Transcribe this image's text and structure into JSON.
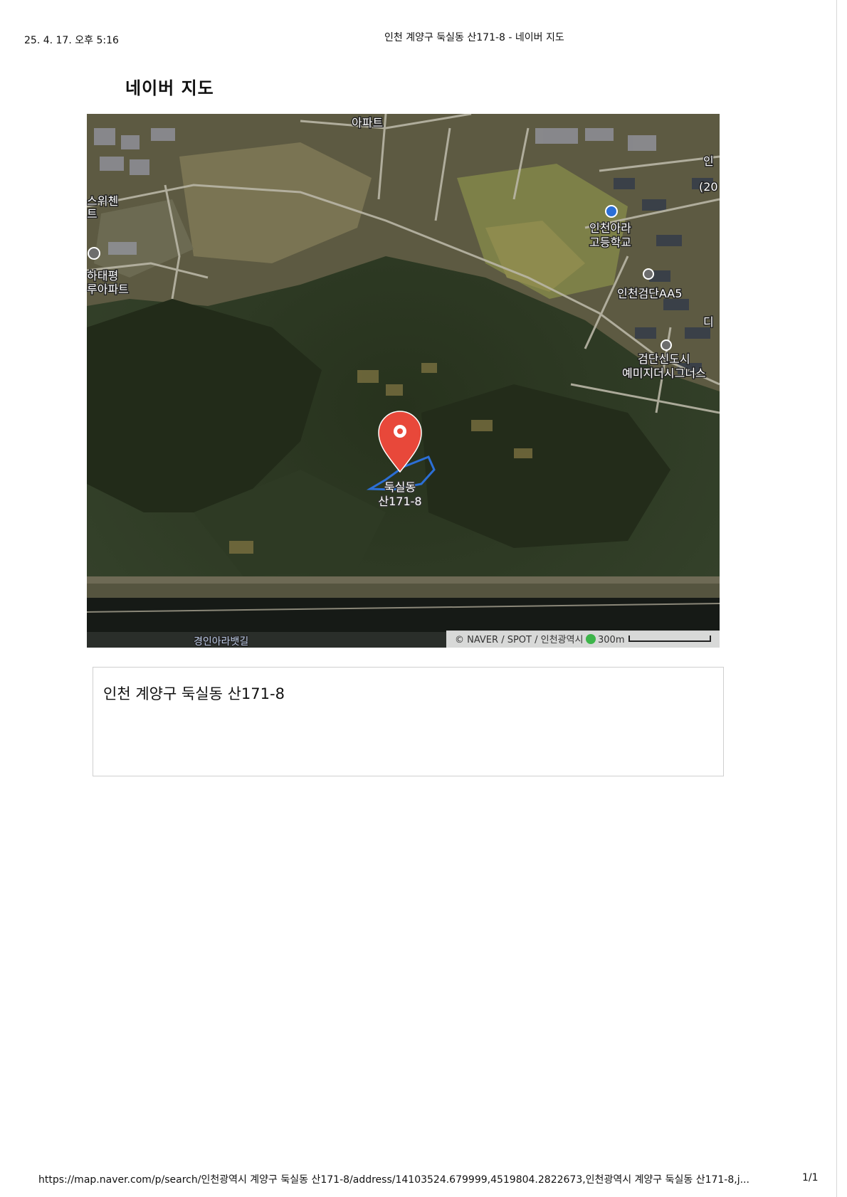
{
  "header": {
    "print_date": "25. 4. 17. 오후 5:16",
    "page_title": "인천 계양구 둑실동 산171-8 - 네이버 지도"
  },
  "brand": {
    "title": "네이버 지도"
  },
  "map": {
    "labels": {
      "apt_top": "아파트",
      "sw_1": "스위첸",
      "sw_2": "트",
      "hapyeong_1": "하태평",
      "hapyeong_2": "루아파트",
      "school_1": "인천아라",
      "school_2": "고등학교",
      "geomdan_aa5": "인천검단AA5",
      "sinsi_1": "검단신도시",
      "sinsi_2": "예미지더시그너스",
      "road": "경인아라뱃길",
      "edge_in": "인",
      "edge_20": "(20",
      "edge_di": "디"
    },
    "marker": {
      "line1": "둑실동",
      "line2": "산171-8"
    },
    "attribution": "© NAVER / SPOT / 인천광역시",
    "scale_label": "300m",
    "colors": {
      "marker": "#e8483a",
      "parcel": "#2c6fd6"
    }
  },
  "address": {
    "text": "인천 계양구 둑실동 산171-8"
  },
  "footer": {
    "url": "https://map.naver.com/p/search/인천광역시 계양구 둑실동 산171-8/address/14103524.679999,4519804.2822673,인천광역시 계양구 둑실동 산171-8,j...",
    "page_count": "1/1"
  }
}
